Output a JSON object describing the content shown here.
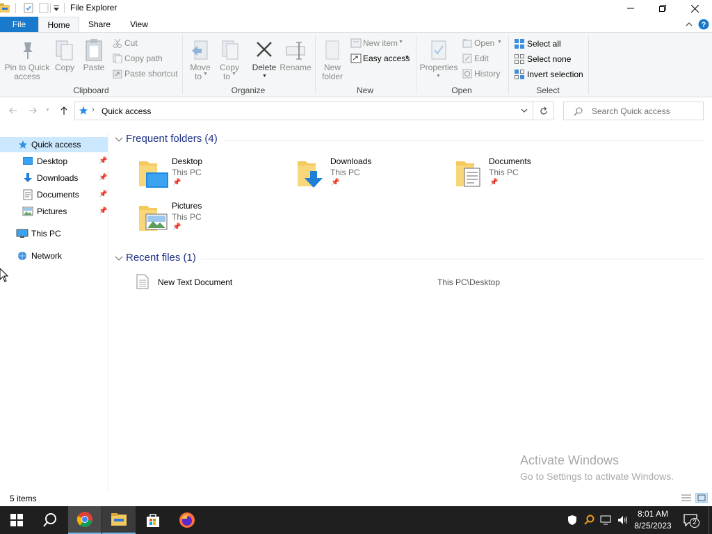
{
  "window": {
    "title": "File Explorer"
  },
  "tabs": [
    {
      "label": "File"
    },
    {
      "label": "Home"
    },
    {
      "label": "Share"
    },
    {
      "label": "View"
    }
  ],
  "ribbon": {
    "clipboard": {
      "pin_label": "Pin to Quick",
      "pin_label2": "access",
      "copy_label": "Copy",
      "paste_label": "Paste",
      "cut_label": "Cut",
      "copy_path_label": "Copy path",
      "paste_shortcut_label": "Paste shortcut",
      "group_label": "Clipboard"
    },
    "organize": {
      "move_label": "Move",
      "move_label2": "to",
      "copy_to_label": "Copy",
      "copy_to_label2": "to",
      "delete_label": "Delete",
      "rename_label": "Rename",
      "group_label": "Organize"
    },
    "new": {
      "new_folder_label": "New",
      "new_folder_label2": "folder",
      "new_item_label": "New item",
      "easy_access_label": "Easy access",
      "group_label": "New"
    },
    "open": {
      "properties_label": "Properties",
      "open_label": "Open",
      "edit_label": "Edit",
      "history_label": "History",
      "group_label": "Open"
    },
    "select": {
      "select_all_label": "Select all",
      "select_none_label": "Select none",
      "invert_label": "Invert selection",
      "group_label": "Select"
    }
  },
  "address": {
    "path": "Quick access",
    "search_placeholder": "Search Quick access"
  },
  "nav": {
    "quick_access": "Quick access",
    "items": [
      {
        "label": "Desktop"
      },
      {
        "label": "Downloads"
      },
      {
        "label": "Documents"
      },
      {
        "label": "Pictures"
      }
    ],
    "this_pc": "This PC",
    "network": "Network"
  },
  "content": {
    "frequent_header": "Frequent folders (4)",
    "folders": [
      {
        "name": "Desktop",
        "location": "This PC"
      },
      {
        "name": "Downloads",
        "location": "This PC"
      },
      {
        "name": "Documents",
        "location": "This PC"
      },
      {
        "name": "Pictures",
        "location": "This PC"
      }
    ],
    "recent_header": "Recent files (1)",
    "recent": [
      {
        "name": "New Text Document",
        "path": "This PC\\Desktop"
      }
    ]
  },
  "watermark": {
    "line1": "Activate Windows",
    "line2": "Go to Settings to activate Windows."
  },
  "status": {
    "items": "5 items"
  },
  "taskbar": {
    "time": "8:01 AM",
    "date": "8/25/2023",
    "notifications": "2"
  },
  "colors": {
    "accent": "#1979ca",
    "selected_nav": "#e5f3ff",
    "folder": "#f4c95d",
    "taskbar": "#1f1f1f"
  }
}
